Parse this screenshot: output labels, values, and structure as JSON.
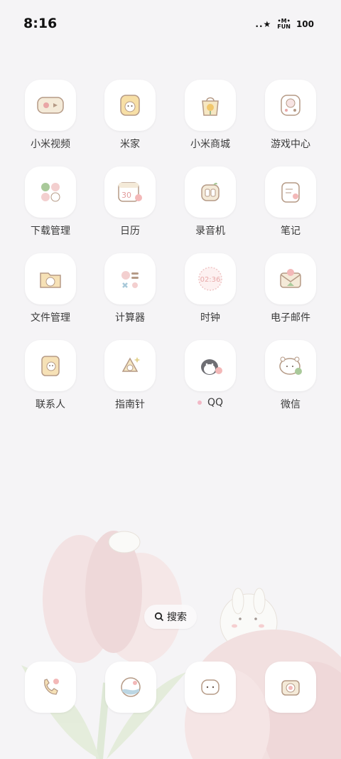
{
  "status_bar": {
    "time": "8:16",
    "signal_text": "..★",
    "fun_badge_top": "•M•",
    "fun_badge_bottom": "FUN",
    "battery": "100"
  },
  "apps": [
    {
      "label": "小米视频",
      "icon": "video-icon"
    },
    {
      "label": "米家",
      "icon": "home-bear-icon"
    },
    {
      "label": "小米商城",
      "icon": "shopping-bag-icon"
    },
    {
      "label": "游戏中心",
      "icon": "game-controller-icon"
    },
    {
      "label": "下载管理",
      "icon": "download-icon"
    },
    {
      "label": "日历",
      "icon": "calendar-icon",
      "calendar_text": "30"
    },
    {
      "label": "录音机",
      "icon": "recorder-icon"
    },
    {
      "label": "笔记",
      "icon": "notes-icon"
    },
    {
      "label": "文件管理",
      "icon": "folder-icon"
    },
    {
      "label": "计算器",
      "icon": "calculator-icon"
    },
    {
      "label": "时钟",
      "icon": "clock-icon",
      "clock_text": "02:36"
    },
    {
      "label": "电子邮件",
      "icon": "mail-icon"
    },
    {
      "label": "联系人",
      "icon": "contacts-icon"
    },
    {
      "label": "指南针",
      "icon": "compass-icon"
    },
    {
      "label": "QQ",
      "icon": "qq-penguin-icon"
    },
    {
      "label": "微信",
      "icon": "wechat-bear-icon"
    }
  ],
  "search": {
    "label": "搜索"
  },
  "dock": [
    {
      "icon": "phone-icon"
    },
    {
      "icon": "browser-icon"
    },
    {
      "icon": "messages-icon"
    },
    {
      "icon": "camera-icon"
    }
  ],
  "colors": {
    "background": "#f5f4f6",
    "tulip_pink": "#f3dede",
    "leaf_green": "#dfe9d6",
    "accent_pink": "#f2b8c6"
  }
}
